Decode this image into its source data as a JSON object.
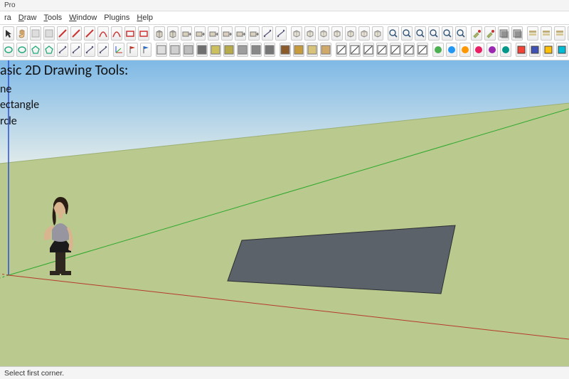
{
  "titlebar": {
    "product": "Pro",
    "document": ""
  },
  "menubar": {
    "items": [
      {
        "label": "ra",
        "underline_index": -1
      },
      {
        "label": "Draw",
        "underline_index": 0
      },
      {
        "label": "Tools",
        "underline_index": 0
      },
      {
        "label": "Window",
        "underline_index": 0
      },
      {
        "label": "Plugins",
        "underline_index": -1
      },
      {
        "label": "Help",
        "underline_index": 0
      }
    ]
  },
  "toolbars": {
    "row1_icons": [
      "pointer",
      "hand",
      "cursor",
      "arrow",
      "line",
      "freehand",
      "line-alt",
      "arc",
      "arc2",
      "rect",
      "rect-rot",
      "|",
      "cube",
      "cube-grp",
      "push",
      "follow",
      "offset",
      "rotate",
      "scale",
      "move",
      "measure",
      "protractor",
      "|",
      "iso",
      "front",
      "back",
      "left",
      "right",
      "top",
      "bottom",
      "|",
      "orbit",
      "pan",
      "zoom",
      "zoom-ext",
      "prev-view",
      "next-view",
      "|",
      "paint",
      "sample",
      "xray",
      "shadow",
      "|",
      "layers",
      "outliner",
      "components",
      "styles",
      "scenes",
      "|",
      "warehouse-globe",
      "warehouse-share",
      "warehouse-get",
      "play",
      "stop",
      "record",
      "export"
    ],
    "row2_icons": [
      "circle",
      "oval",
      "polygon",
      "star",
      "dims",
      "text",
      "label",
      "callout",
      "|",
      "axes",
      "red-flag",
      "blue-flag",
      "|",
      "shade-1",
      "shade-2",
      "shade-3",
      "shade-4",
      "shade-5",
      "shade-6",
      "shade-7",
      "shade-8",
      "shade-9",
      "|",
      "brown",
      "ochre",
      "sand",
      "tan",
      "|",
      "edge-1",
      "edge-2",
      "edge-3",
      "edge-4",
      "edge-5",
      "edge-6",
      "edge-7",
      "|",
      "g1",
      "g2",
      "g3",
      "g4",
      "g5",
      "g6",
      "|",
      "c1",
      "c2",
      "c3",
      "c4"
    ]
  },
  "overlay": {
    "title": "asic 2D Drawing Tools:",
    "items": [
      "ne",
      "ectangle",
      "rcle"
    ]
  },
  "statusbar": {
    "hint": "Select first corner."
  },
  "colors": {
    "sky_top": "#7fb9e6",
    "sky_bottom": "#dfeaea",
    "ground": "#bac98e",
    "rect_fill": "#5c626a",
    "axis_blue": "#2a4fd8",
    "axis_red": "#b43a2a",
    "axis_green": "#2aa82a"
  }
}
